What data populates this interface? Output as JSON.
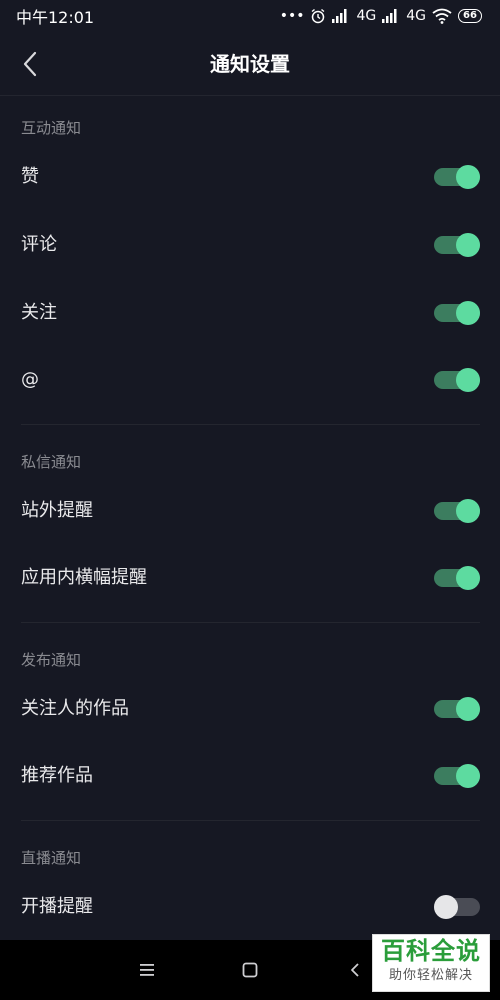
{
  "status_bar": {
    "time": "中午12:01",
    "network_1": "4G",
    "network_2": "4G",
    "battery": "66"
  },
  "header": {
    "title": "通知设置"
  },
  "sections": [
    {
      "label": "互动通知",
      "items": [
        {
          "label": "赞",
          "enabled": true
        },
        {
          "label": "评论",
          "enabled": true
        },
        {
          "label": "关注",
          "enabled": true
        },
        {
          "label": "@",
          "enabled": true
        }
      ]
    },
    {
      "label": "私信通知",
      "items": [
        {
          "label": "站外提醒",
          "enabled": true
        },
        {
          "label": "应用内横幅提醒",
          "enabled": true
        }
      ]
    },
    {
      "label": "发布通知",
      "items": [
        {
          "label": "关注人的作品",
          "enabled": true
        },
        {
          "label": "推荐作品",
          "enabled": true
        }
      ]
    },
    {
      "label": "直播通知",
      "items": [
        {
          "label": "开播提醒",
          "enabled": false
        }
      ]
    }
  ],
  "watermark": {
    "title": "百科全说",
    "subtitle": "助你轻松解决"
  },
  "colors": {
    "background": "#161823",
    "switch_on_track": "#3c7d5f",
    "switch_on_knob": "#5ddba0",
    "switch_off_track": "#4a4c55",
    "switch_off_knob": "#e6e6e8",
    "watermark_green": "#2a9d3a"
  }
}
